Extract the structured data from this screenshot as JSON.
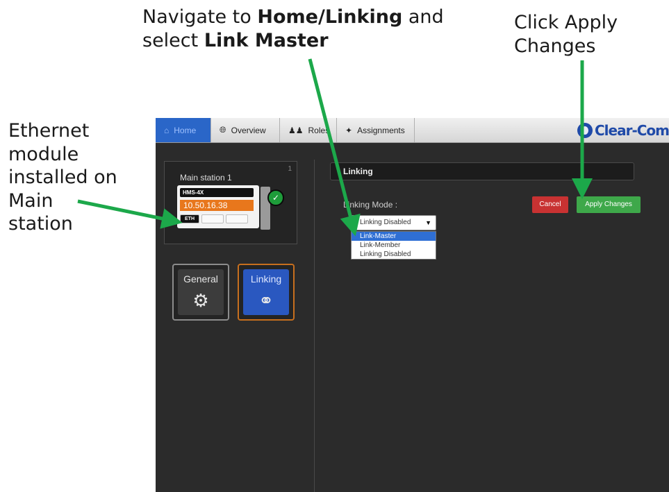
{
  "annotations": {
    "top_line1_pre": "Navigate to ",
    "top_line1_bold": "Home/Linking",
    "top_line1_post": " and",
    "top_line2_pre": "select ",
    "top_line2_bold": "Link Master",
    "right_line1": "Click Apply",
    "right_line2": "Changes",
    "left_lines": [
      "Ethernet",
      "module",
      "installed on",
      "Main",
      "station"
    ]
  },
  "navbar": {
    "tabs": [
      {
        "label": "Home",
        "icon": "home-icon",
        "active": true
      },
      {
        "label": "Overview",
        "icon": "globe-icon",
        "active": false
      },
      {
        "label": "Roles",
        "icon": "users-icon",
        "active": false
      },
      {
        "label": "Assignments",
        "icon": "assignments-icon",
        "active": false
      }
    ],
    "logo_text": "Clear-Com"
  },
  "station": {
    "number": "1",
    "name": "Main station 1",
    "model": "HMS-4X",
    "ip": "10.50.16.38",
    "slot_label": "ETH"
  },
  "sidebar_buttons": {
    "general": "General",
    "linking": "Linking"
  },
  "panel": {
    "header": "Linking",
    "mode_label": "Linking Mode :",
    "select_value": "Linking Disabled",
    "options": [
      "Link-Master",
      "Link-Member",
      "Linking Disabled"
    ],
    "selected_option": "Link-Master",
    "cancel_label": "Cancel",
    "apply_label": "Apply Changes"
  },
  "colors": {
    "arrow": "#1ca84a",
    "home_tab": "#2a66c8",
    "ip_badge": "#e8771c",
    "cancel": "#c83232",
    "apply": "#3ea84a"
  }
}
